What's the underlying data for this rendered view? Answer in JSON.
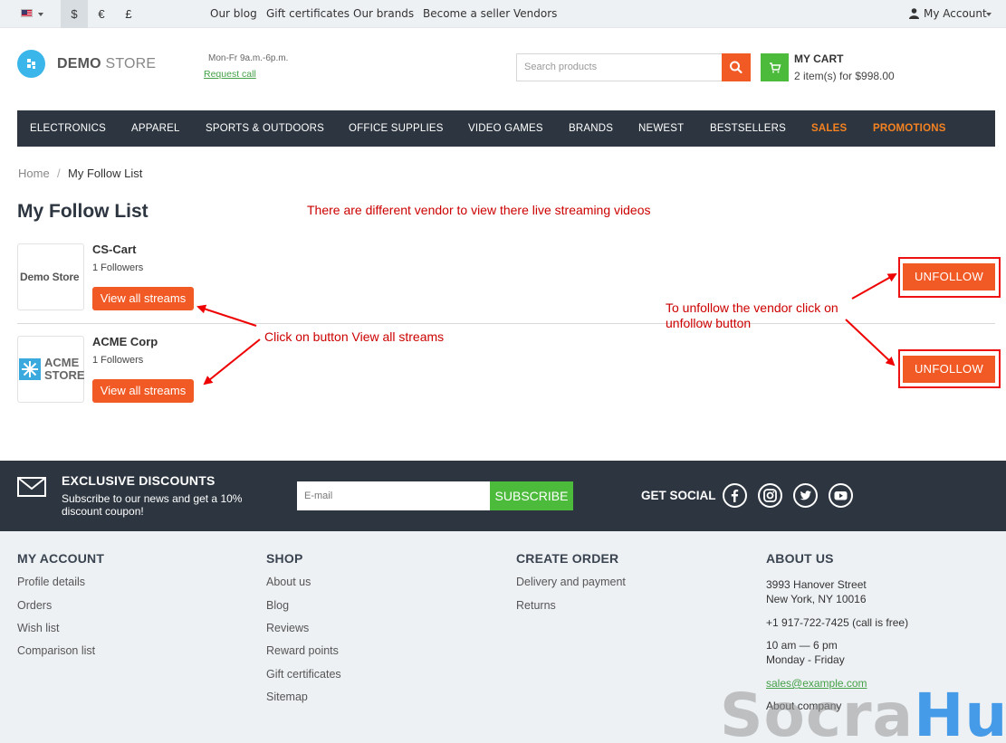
{
  "topbar": {
    "currencies": [
      "$",
      "€",
      "£"
    ],
    "links": [
      "Our blog",
      "Gift certificates",
      "Our brands",
      "Become a seller",
      "Vendors"
    ],
    "account": "My Account"
  },
  "header": {
    "logo_bold": "DEMO",
    "logo_light": " STORE",
    "hours": "Mon-Fr 9a.m.-6p.m.",
    "request_call": "Request call",
    "search_placeholder": "Search products",
    "cart_title": "MY CART",
    "cart_summary": "2 item(s) for $998.00"
  },
  "nav": {
    "items": [
      "ELECTRONICS",
      "APPAREL",
      "SPORTS & OUTDOORS",
      "OFFICE SUPPLIES",
      "VIDEO GAMES",
      "BRANDS",
      "NEWEST",
      "BESTSELLERS",
      "SALES",
      "PROMOTIONS"
    ]
  },
  "breadcrumb": {
    "home": "Home",
    "sep": "/",
    "current": "My Follow List"
  },
  "page": {
    "title": "My Follow List",
    "annotation_top": "There are different vendor to view there live streaming videos",
    "annotation_click": "Click on button View all streams",
    "annotation_unfollow": "To unfollow the vendor click on unfollow button"
  },
  "vendors": [
    {
      "name": "CS-Cart",
      "followers": "1 Followers",
      "logo_text": "Demo Store",
      "view_label": "View all streams",
      "unfollow_label": "UNFOLLOW"
    },
    {
      "name": "ACME Corp",
      "followers": "1 Followers",
      "logo_line1": "ACME",
      "logo_line2": "STORE",
      "view_label": "View all streams",
      "unfollow_label": "UNFOLLOW"
    }
  ],
  "newsletter": {
    "title": "EXCLUSIVE DISCOUNTS",
    "subtitle": "Subscribe to our news and get a 10% discount coupon!",
    "email_placeholder": "E-mail",
    "subscribe_label": "SUBSCRIBE",
    "social_title": "GET SOCIAL"
  },
  "footer": {
    "my_account": {
      "title": "MY ACCOUNT",
      "links": [
        "Profile details",
        "Orders",
        "Wish list",
        "Comparison list"
      ]
    },
    "shop": {
      "title": "SHOP",
      "links": [
        "About us",
        "Blog",
        "Reviews",
        "Reward points",
        "Gift certificates",
        "Sitemap"
      ]
    },
    "create_order": {
      "title": "CREATE ORDER",
      "links": [
        "Delivery and payment",
        "Returns"
      ]
    },
    "about": {
      "title": "ABOUT US",
      "address1": "3993 Hanover Street",
      "address2": "New York, NY 10016",
      "phone": "+1 917-722-7425 (call is free)",
      "hours1": "10 am — 6 pm",
      "hours2": "Monday - Friday",
      "email": "sales@example.com",
      "company": "About company"
    }
  },
  "watermark": {
    "part1": "Socra",
    "part2": "Hub"
  },
  "colors": {
    "accent": "#f15a24",
    "green": "#4cba3b",
    "dark": "#2d3640",
    "annotation": "#cc0000"
  }
}
